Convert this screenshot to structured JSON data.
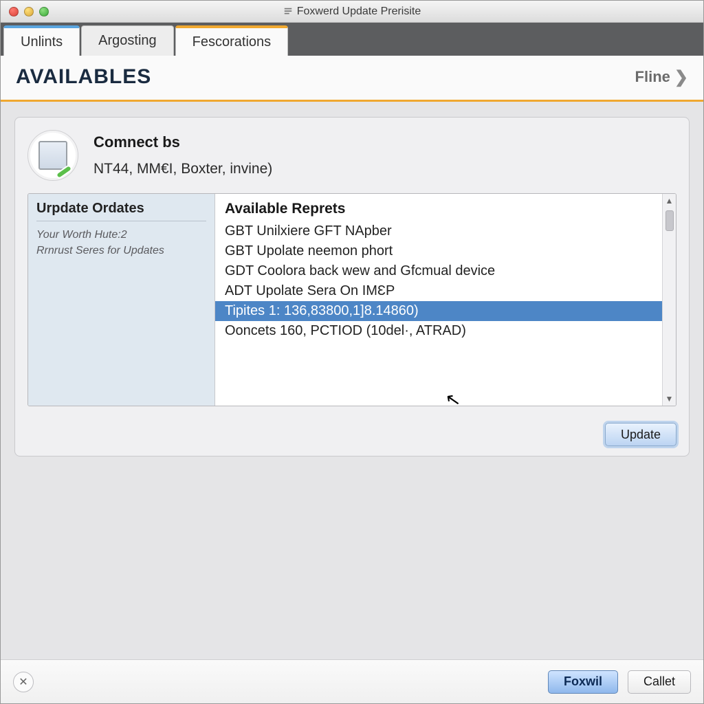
{
  "window": {
    "title": "Foxwerd Update Prerisite"
  },
  "tabs": [
    {
      "label": "Unlints",
      "state": "first"
    },
    {
      "label": "Argosting",
      "state": "inactive"
    },
    {
      "label": "Fescorations",
      "state": "active"
    }
  ],
  "header": {
    "title": "AVAILABLES",
    "next_label": "Fline"
  },
  "connect": {
    "title": "Comnect bs",
    "subtitle": "NT44, MM€I, Boxter, invine)"
  },
  "sidebar": {
    "title": "Urpdate Ordates",
    "lines": [
      "Your Worth Hute:2",
      "Rrnrust Seres for Updates"
    ]
  },
  "list": {
    "title": "Available Reprets",
    "items": [
      {
        "label": "GBT Unilxiere GFT NApber",
        "selected": false
      },
      {
        "label": "GBT Upolate neemon phort",
        "selected": false
      },
      {
        "label": "GDT Coolora back wew and Gfϲmual device",
        "selected": false
      },
      {
        "label": "ADT Upolate Sera On IMƐP",
        "selected": false
      },
      {
        "label": "Tipites 1: 136,83800,1]8.14860)",
        "selected": true
      },
      {
        "label": "Ooncets 160, PCTIOD (10del·, ATRAD)",
        "selected": false
      }
    ]
  },
  "buttons": {
    "update": "Update",
    "footer_primary": "Foxwil",
    "footer_secondary": "Callet",
    "footer_left_glyph": "✕"
  }
}
